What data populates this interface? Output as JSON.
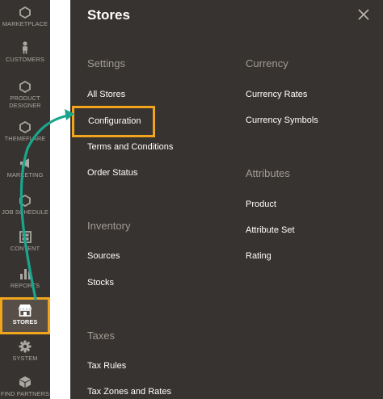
{
  "sidebar": {
    "items": [
      {
        "label": "MARKETPLACE",
        "icon": "hexagon-icon"
      },
      {
        "label": "CUSTOMERS",
        "icon": "person-icon"
      },
      {
        "label": "PRODUCT\nDESIGNER",
        "icon": "hexagon-icon"
      },
      {
        "label": "THEMEFLARE",
        "icon": "hexagon-icon"
      },
      {
        "label": "MARKETING",
        "icon": "megaphone-icon"
      },
      {
        "label": "JOB SCHEDULE",
        "icon": "hexagon-icon"
      },
      {
        "label": "CONTENT",
        "icon": "layout-icon"
      },
      {
        "label": "REPORTS",
        "icon": "bar-chart-icon"
      },
      {
        "label": "STORES",
        "icon": "storefront-icon",
        "active": true
      },
      {
        "label": "SYSTEM",
        "icon": "gear-icon"
      },
      {
        "label": "FIND PARTNERS",
        "icon": "cube-icon"
      }
    ]
  },
  "panel": {
    "title": "Stores",
    "close_icon": "close-icon",
    "sections": {
      "settings": {
        "heading": "Settings",
        "links": [
          "All Stores",
          "Configuration",
          "Terms and Conditions",
          "Order Status"
        ]
      },
      "inventory": {
        "heading": "Inventory",
        "links": [
          "Sources",
          "Stocks"
        ]
      },
      "taxes": {
        "heading": "Taxes",
        "links": [
          "Tax Rules",
          "Tax Zones and Rates"
        ]
      },
      "currency": {
        "heading": "Currency",
        "links": [
          "Currency Rates",
          "Currency Symbols"
        ]
      },
      "attributes": {
        "heading": "Attributes",
        "links": [
          "Product",
          "Attribute Set",
          "Rating"
        ]
      }
    }
  },
  "colors": {
    "background": "#373330",
    "highlight": "#f1a51c",
    "arrow": "#1aa58c",
    "heading": "#a29c95",
    "sidebar_text": "#aaa6a0"
  }
}
